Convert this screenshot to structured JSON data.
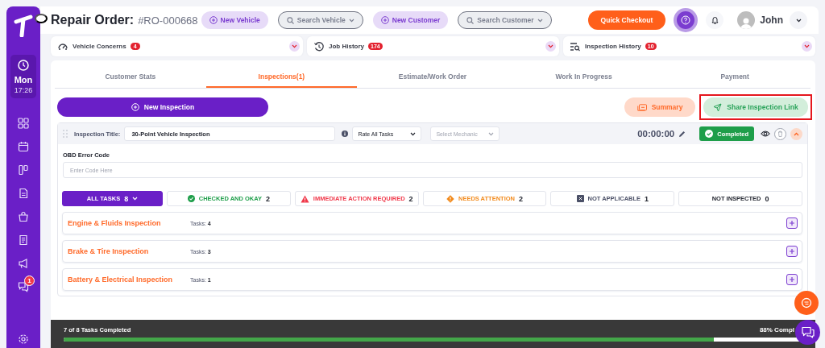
{
  "sidebar": {
    "day": "Mon",
    "time": "17:26",
    "nav": [
      {
        "kind": "grid"
      },
      {
        "kind": "calendar"
      },
      {
        "kind": "board"
      },
      {
        "kind": "document"
      },
      {
        "kind": "bag"
      },
      {
        "kind": "receipt"
      },
      {
        "kind": "megaphone"
      },
      {
        "kind": "chat",
        "badge": "1"
      },
      {
        "kind": "settings"
      }
    ]
  },
  "header": {
    "title": "Repair Order:",
    "order_number": "#RO-000668",
    "new_vehicle": "New Vehicle",
    "search_vehicle": "Search Vehicle",
    "new_customer": "New Customer",
    "search_customer": "Search Customer",
    "quick_checkout": "Quick Checkout",
    "user": "John"
  },
  "panels": [
    {
      "kind": "concerns",
      "label": "Vehicle Concerns",
      "count": "4"
    },
    {
      "kind": "history",
      "label": "Job History",
      "count": "174"
    },
    {
      "kind": "inspection",
      "label": "Inspection History",
      "count": "10"
    }
  ],
  "tabs": [
    {
      "label": "Customer Stats",
      "selected": false
    },
    {
      "label": "Inspections(1)",
      "selected": true
    },
    {
      "label": "Estimate/Work Order",
      "selected": false
    },
    {
      "label": "Work In Progress",
      "selected": false
    },
    {
      "label": "Payment",
      "selected": false
    }
  ],
  "actions": {
    "new_inspection": "New Inspection",
    "summary": "Summary",
    "share": "Share Inspection Link",
    "share_highlighted": true
  },
  "inspection": {
    "title_label": "Inspection Title:",
    "title_value": "30-Point Vehicle Inspection",
    "rate_select": "Rate All Tasks",
    "mechanic_placeholder": "Select Mechanic",
    "timer": "00:00:00",
    "status": "Completed",
    "expanded": true,
    "obd_label": "OBD Error Code",
    "obd_placeholder": "Enter Code Here"
  },
  "filters": [
    {
      "kind": "all",
      "label": "ALL TASKS",
      "count": "8",
      "selected": true
    },
    {
      "kind": "ok",
      "label": "CHECKED AND OKAY",
      "count": "2",
      "color": "#1e9e4a",
      "selected": false
    },
    {
      "kind": "urgent",
      "label": "IMMEDIATE ACTION REQUIRED",
      "count": "2",
      "color": "#f0384a",
      "selected": false
    },
    {
      "kind": "attention",
      "label": "NEEDS ATTENTION",
      "count": "2",
      "color": "#f28a1c",
      "selected": false
    },
    {
      "kind": "na",
      "label": "NOT APPLICABLE",
      "count": "1",
      "color": "#4b5067",
      "selected": false
    },
    {
      "kind": "none",
      "label": "NOT INSPECTED",
      "count": "0",
      "color": "#22252f",
      "selected": false
    }
  ],
  "categories": [
    {
      "name": "Engine & Fluids Inspection",
      "tasks_label": "Tasks:",
      "tasks": "4"
    },
    {
      "name": "Brake & Tire Inspection",
      "tasks_label": "Tasks:",
      "tasks": "3"
    },
    {
      "name": "Battery & Electrical Inspection",
      "tasks_label": "Tasks:",
      "tasks": "1"
    }
  ],
  "progress": {
    "text": "7 of 8 Tasks Completed",
    "level": 0.88,
    "percent": "88% Compl"
  }
}
